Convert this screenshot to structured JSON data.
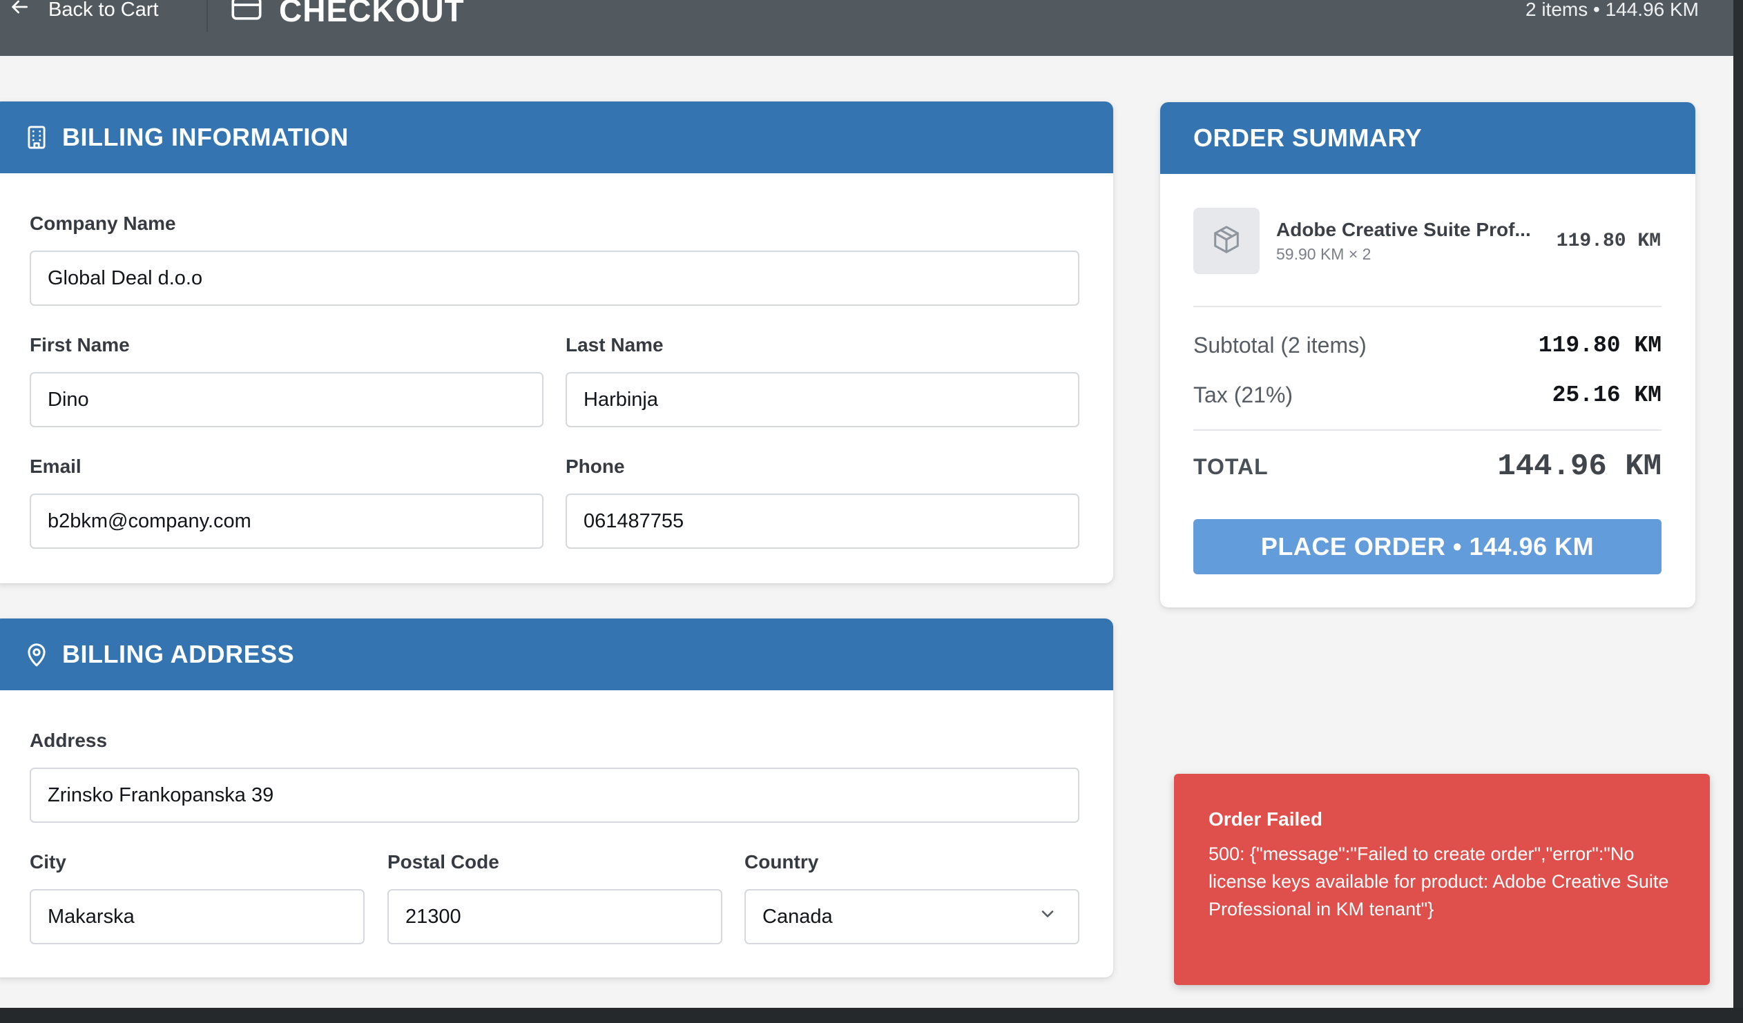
{
  "header": {
    "back_label": "Back to Cart",
    "title": "CHECKOUT",
    "cart_summary": "2 items • 144.96 KM"
  },
  "billing_info": {
    "heading": "BILLING INFORMATION",
    "company": {
      "label": "Company Name",
      "value": "Global Deal d.o.o"
    },
    "first_name": {
      "label": "First Name",
      "value": "Dino"
    },
    "last_name": {
      "label": "Last Name",
      "value": "Harbinja"
    },
    "email": {
      "label": "Email",
      "value": "b2bkm@company.com"
    },
    "phone": {
      "label": "Phone",
      "value": "061487755"
    }
  },
  "billing_address": {
    "heading": "BILLING ADDRESS",
    "address": {
      "label": "Address",
      "value": "Zrinsko Frankopanska 39"
    },
    "city": {
      "label": "City",
      "value": "Makarska"
    },
    "postal_code": {
      "label": "Postal Code",
      "value": "21300"
    },
    "country": {
      "label": "Country",
      "value": "Canada"
    }
  },
  "order_summary": {
    "heading": "ORDER SUMMARY",
    "item": {
      "name": "Adobe Creative Suite Prof...",
      "unit_qty": "59.90 KM × 2",
      "total": "119.80 KM"
    },
    "subtotal_label": "Subtotal (2 items)",
    "subtotal_value": "119.80 KM",
    "tax_label": "Tax (21%)",
    "tax_value": "25.16 KM",
    "total_label": "TOTAL",
    "total_value": "144.96 KM",
    "place_order_label": "PLACE ORDER • 144.96 KM"
  },
  "toast": {
    "title": "Order Failed",
    "message": "500: {\"message\":\"Failed to create order\",\"error\":\"No license keys available for product: Adobe Creative Suite Professional in KM tenant\"}"
  },
  "icons": {
    "back": "arrow-left-icon",
    "checkout": "credit-card-icon",
    "billing_info": "building-icon",
    "billing_address": "map-pin-icon",
    "product": "package-icon",
    "select": "chevron-down-icon"
  },
  "colors": {
    "topbar": "#535a5f",
    "card_header": "#3374b1",
    "place_order_button": "#629cdb",
    "toast_error": "#df504c",
    "page_background": "#f4f4f4"
  }
}
